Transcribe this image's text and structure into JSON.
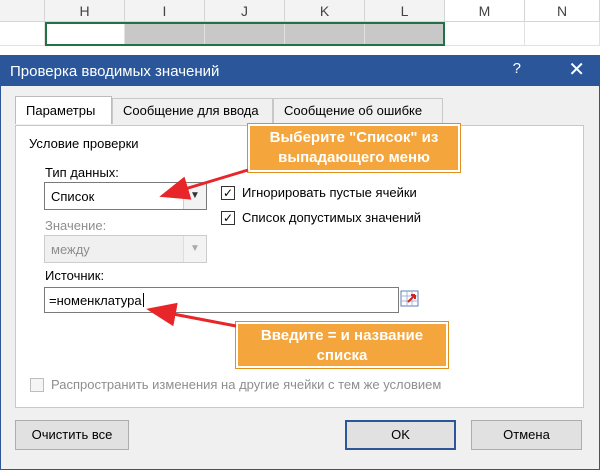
{
  "spreadsheet": {
    "columns": [
      "H",
      "I",
      "J",
      "K",
      "L",
      "M",
      "N"
    ]
  },
  "dialog": {
    "title": "Проверка вводимых значений",
    "help_glyph": "?",
    "close_glyph": "✕",
    "tabs": [
      {
        "label": "Параметры",
        "active": true
      },
      {
        "label": "Сообщение для ввода",
        "active": false
      },
      {
        "label": "Сообщение об ошибке",
        "active": false
      }
    ],
    "group_label": "Условие проверки",
    "data_type_label": "Тип данных:",
    "data_type_value": "Список",
    "value_label": "Значение:",
    "value_value": "между",
    "ignore_blank_label": "Игнорировать пустые ячейки",
    "ignore_blank_checked": true,
    "dropdown_label": "Список допустимых значений",
    "dropdown_checked": true,
    "source_label": "Источник:",
    "source_value": "=номенклатура",
    "propagate_label": "Распространить изменения на другие ячейки с тем же условием",
    "propagate_checked": false,
    "clear_all_button": "Очистить все",
    "ok_button": "OK",
    "cancel_button": "Отмена"
  },
  "callouts": {
    "select_list_line1": "Выберите \"Список\" из",
    "select_list_line2": "выпадающего меню",
    "enter_name_line1": "Введите = и название",
    "enter_name_line2": "списка"
  },
  "colors": {
    "titlebar": "#2b579a",
    "callout": "#f4a53b",
    "arrow": "#e8262a",
    "excel_green": "#217346"
  }
}
